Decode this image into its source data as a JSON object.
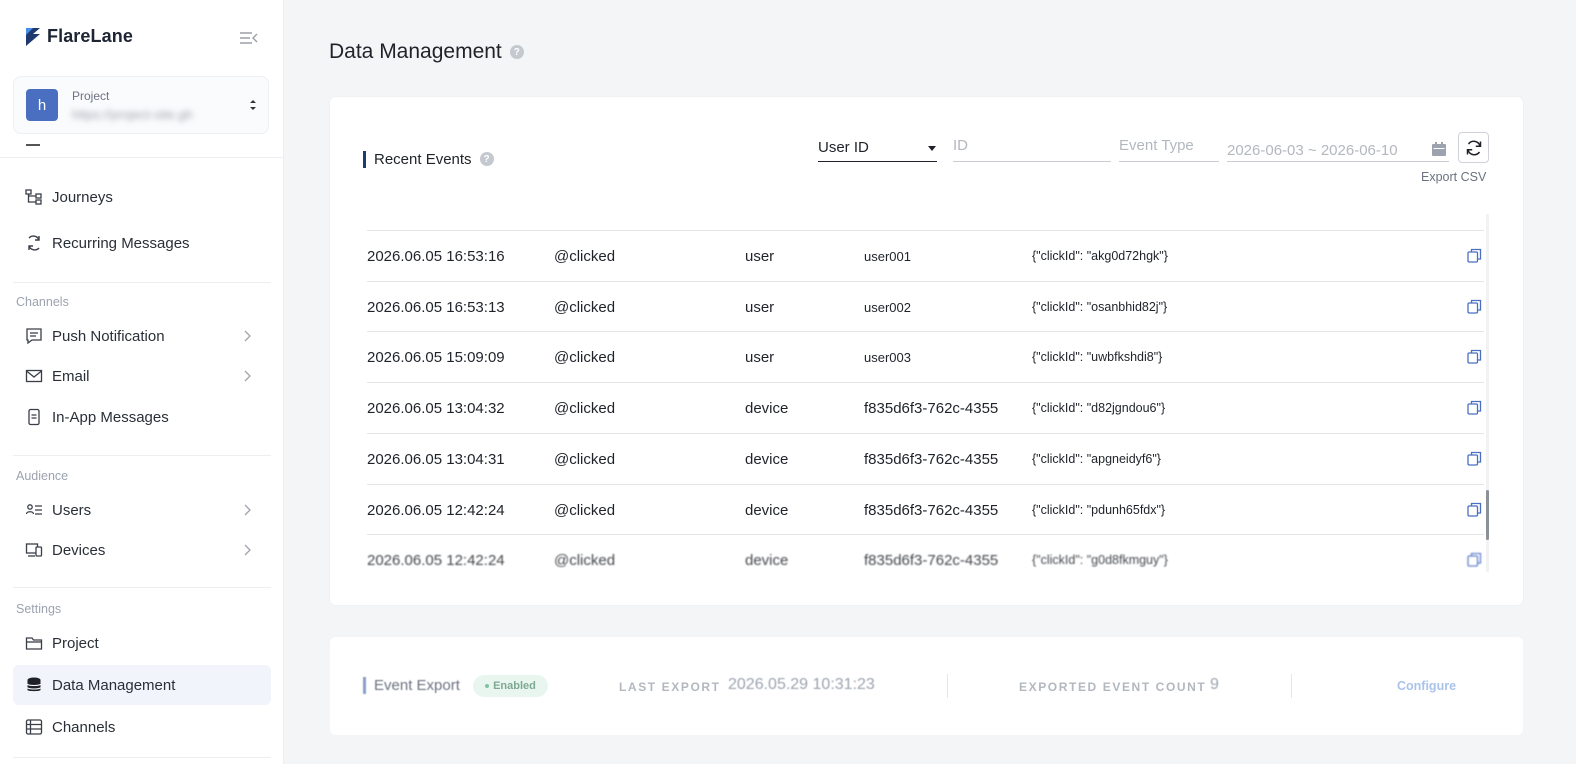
{
  "brand": {
    "name": "FlareLane"
  },
  "project": {
    "avatar_letter": "h",
    "label": "Project",
    "value": "https://project-site.gh"
  },
  "nav": {
    "journeys": "Journeys",
    "recurring": "Recurring Messages",
    "channels_section": "Channels",
    "push": "Push Notification",
    "email": "Email",
    "inapp": "In-App Messages",
    "audience_section": "Audience",
    "users": "Users",
    "devices": "Devices",
    "settings_section": "Settings",
    "project": "Project",
    "data_management": "Data Management",
    "channels": "Channels"
  },
  "page": {
    "title": "Data Management"
  },
  "recent_events": {
    "title": "Recent Events",
    "filter_select": "User ID",
    "id_placeholder": "ID",
    "event_type_placeholder": "Event Type",
    "date_range": "2026-06-03 ~ 2026-06-10",
    "export_csv": "Export CSV",
    "rows": [
      {
        "time": "2026.06.05 16:53:16",
        "event": "@clicked",
        "subject": "user",
        "id": "user001",
        "props": "{\"clickId\": \"akg0d72hgk\"}"
      },
      {
        "time": "2026.06.05 16:53:13",
        "event": "@clicked",
        "subject": "user",
        "id": "user002",
        "props": "{\"clickId\": \"osanbhid82j\"}"
      },
      {
        "time": "2026.06.05 15:09:09",
        "event": "@clicked",
        "subject": "user",
        "id": "user003",
        "props": "{\"clickId\": \"uwbfkshdi8\"}"
      },
      {
        "time": "2026.06.05 13:04:32",
        "event": "@clicked",
        "subject": "device",
        "id": "f835d6f3-762c-4355",
        "props": "{\"clickId\": \"d82jgndou6\"}"
      },
      {
        "time": "2026.06.05 13:04:31",
        "event": "@clicked",
        "subject": "device",
        "id": "f835d6f3-762c-4355",
        "props": "{\"clickId\": \"apgneidyf6\"}"
      },
      {
        "time": "2026.06.05 12:42:24",
        "event": "@clicked",
        "subject": "device",
        "id": "f835d6f3-762c-4355",
        "props": "{\"clickId\": \"pdunh65fdx\"}"
      },
      {
        "time": "2026.06.05 12:42:24",
        "event": "@clicked",
        "subject": "device",
        "id": "f835d6f3-762c-4355",
        "props": "{\"clickId\": \"g0d8fkmguy\"}"
      }
    ]
  },
  "event_export": {
    "title": "Event Export",
    "status": "Enabled",
    "last_export_label": "LAST EXPORT",
    "last_export_value": "2026.05.29 10:31:23",
    "count_label": "EXPORTED EVENT COUNT",
    "count_value": "9",
    "configure": "Configure"
  },
  "colors": {
    "accent": "#4a6fc1",
    "brand_dark": "#1f3a6e",
    "active_bg": "#f1f4fb"
  }
}
